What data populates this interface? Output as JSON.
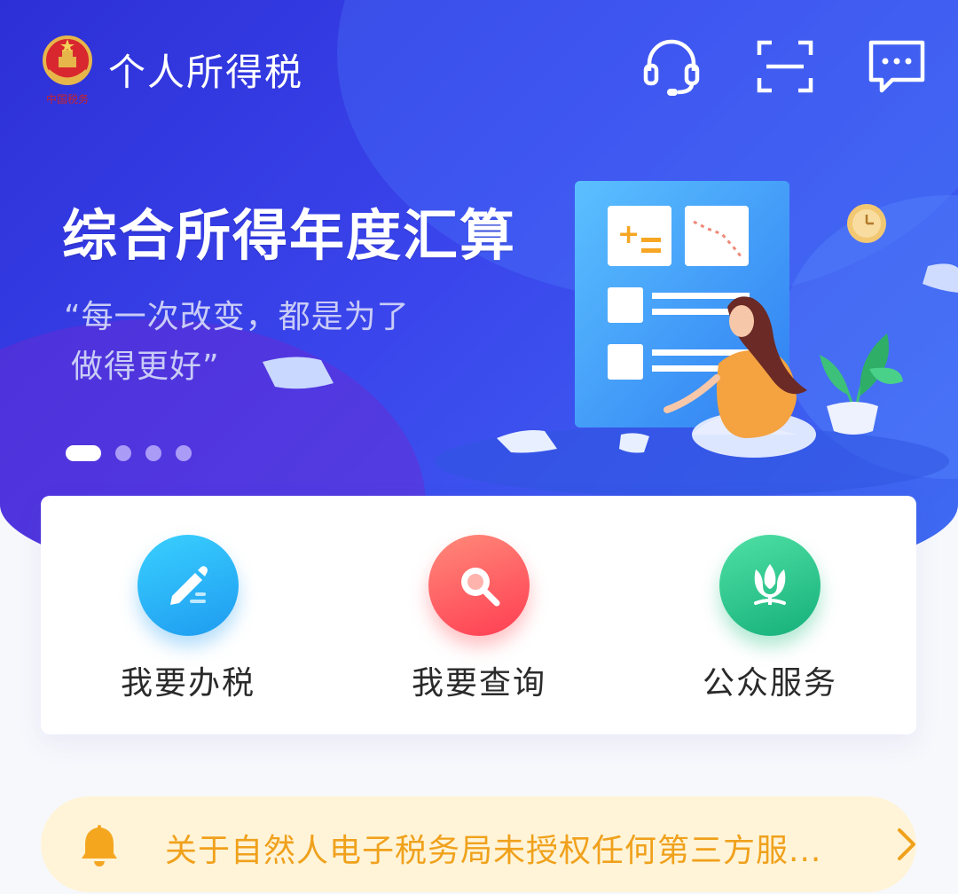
{
  "header": {
    "app_title": "个人所得税",
    "emblem_text": "中国税务",
    "icons": [
      "headset-icon",
      "scan-icon",
      "message-icon"
    ]
  },
  "banner": {
    "title": "综合所得年度汇算",
    "quote_line1": "“每一次改变，都是为了",
    "quote_line2": "做得更好”",
    "slide_count": 4,
    "active_slide": 1
  },
  "services": [
    {
      "label": "我要办税",
      "icon": "edit-icon",
      "color": "#1e9bf0"
    },
    {
      "label": "我要查询",
      "icon": "search-icon",
      "color": "#ff3d52"
    },
    {
      "label": "公众服务",
      "icon": "tulip-icon",
      "color": "#16b07a"
    }
  ],
  "notice": {
    "text": "关于自然人电子税务局未授权任何第三方服...",
    "icon": "bell-icon",
    "color": "#f0a11c",
    "background": "#fff4d8"
  },
  "colors": {
    "hero_start": "#2d2fd6",
    "hero_end": "#3f6df2",
    "page_background": "#f7f8fc"
  }
}
